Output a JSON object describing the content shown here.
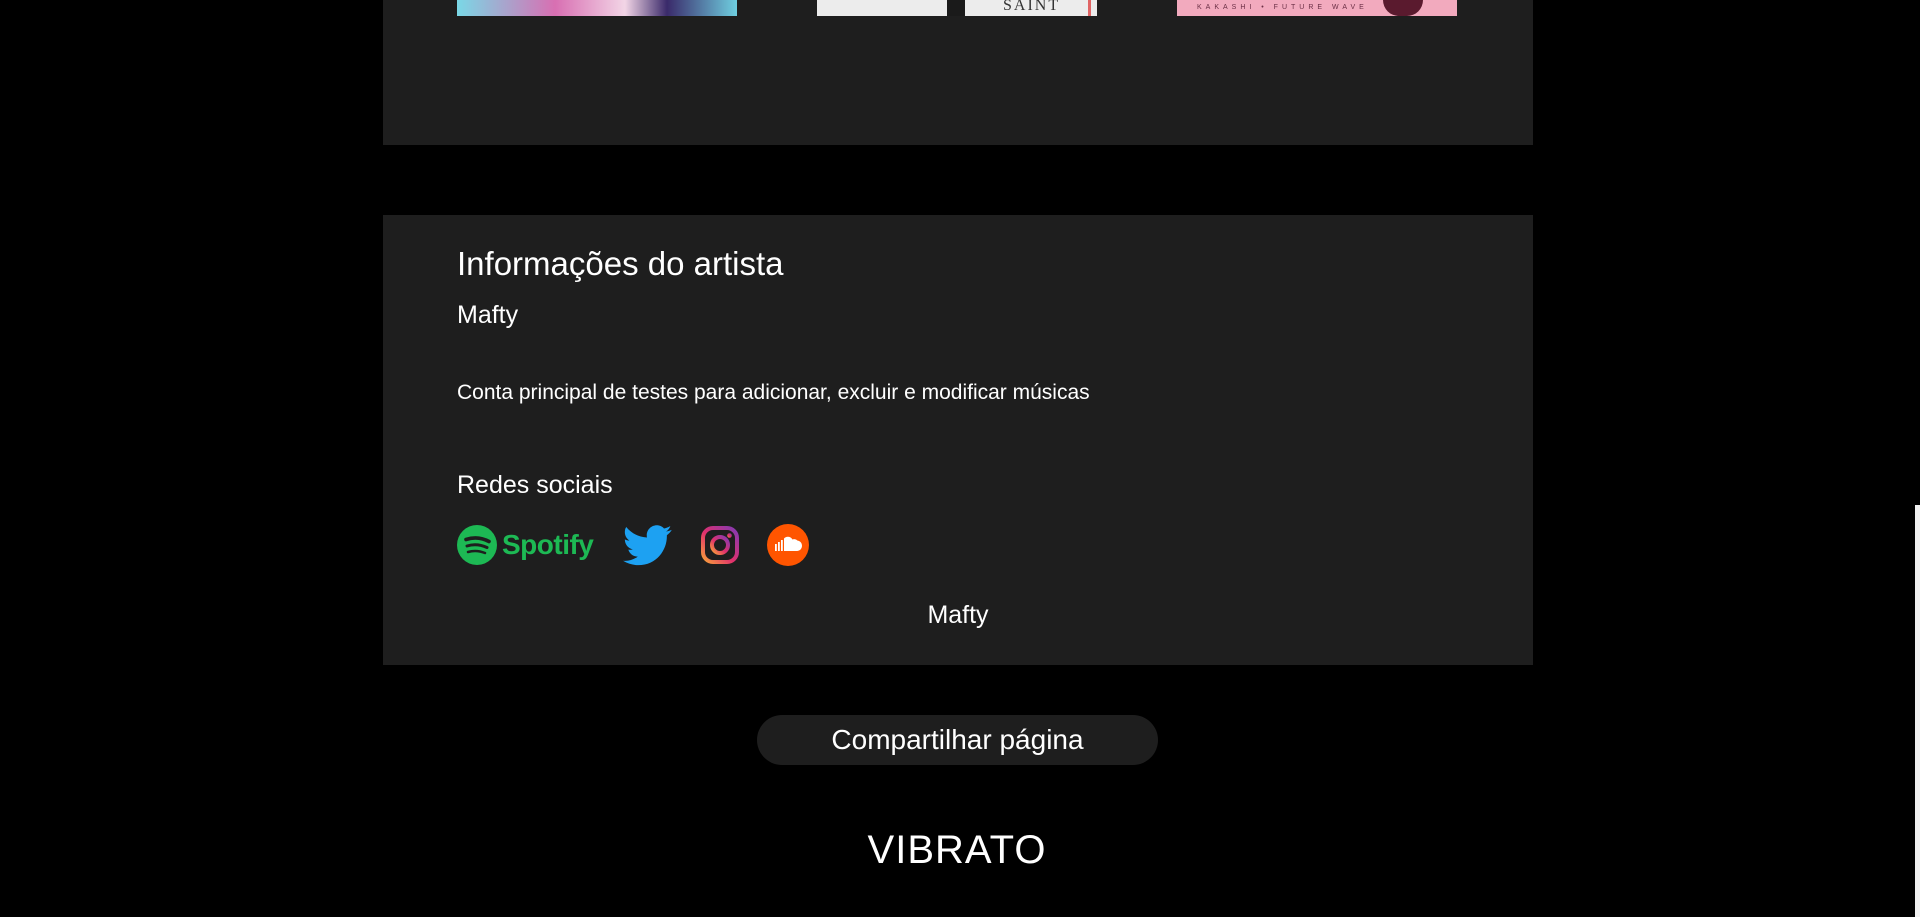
{
  "artist_info": {
    "title": "Informações do artista",
    "name": "Mafty",
    "description": "Conta principal de testes para adicionar, excluir e modificar músicas",
    "social_title": "Redes sociais",
    "social_links": [
      {
        "icon": "spotify-icon",
        "label": "Spotify",
        "color": "#1db954"
      },
      {
        "icon": "twitter-icon",
        "color": "#1da1f2"
      },
      {
        "icon": "instagram-icon",
        "color": "#c13584"
      },
      {
        "icon": "soundcloud-icon",
        "color": "#ff5500"
      }
    ],
    "footer_name": "Mafty"
  },
  "albums": {
    "cover_texts": [
      "SAINT",
      "KAKASHI • FUTURE WAVE"
    ]
  },
  "share_button": {
    "label": "Compartilhar página"
  },
  "brand": {
    "name": "VIBRATO"
  },
  "colors": {
    "background": "#000000",
    "panel": "#1e1e1e",
    "text": "#ffffff"
  }
}
